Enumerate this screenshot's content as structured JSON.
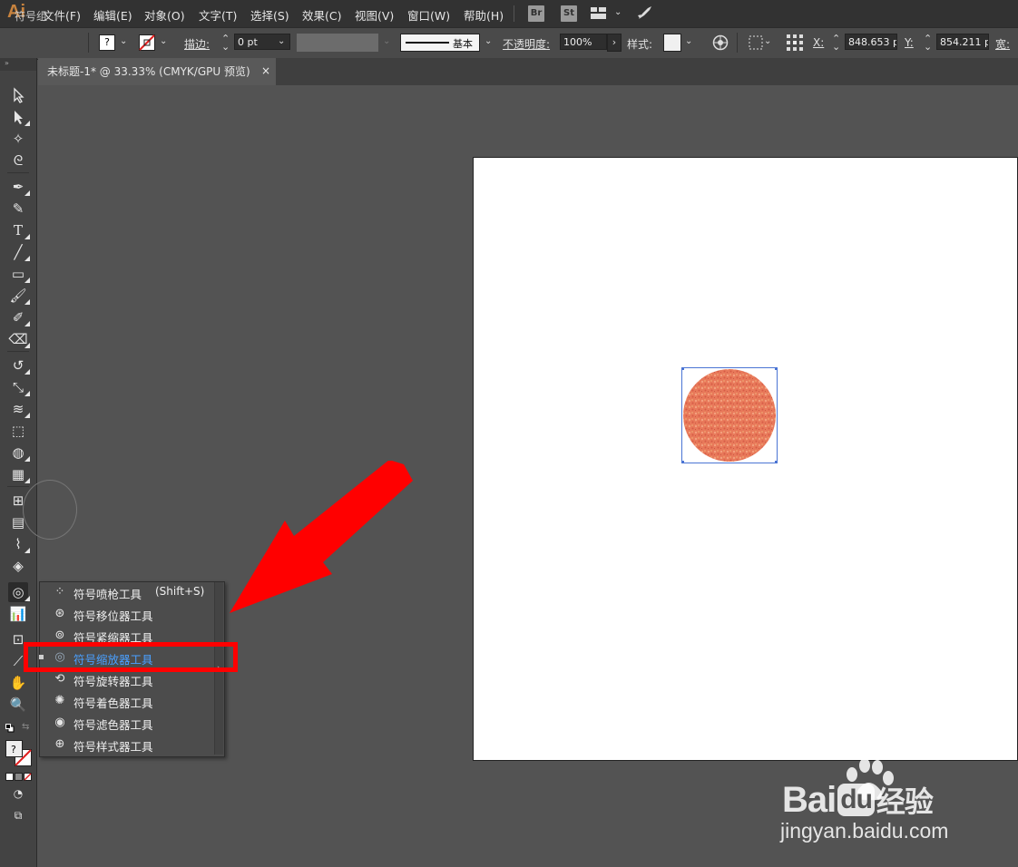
{
  "app": {
    "logo": "Ai"
  },
  "menubar": {
    "items": [
      {
        "label": "文件(F)"
      },
      {
        "label": "编辑(E)"
      },
      {
        "label": "对象(O)"
      },
      {
        "label": "文字(T)"
      },
      {
        "label": "选择(S)"
      },
      {
        "label": "效果(C)"
      },
      {
        "label": "视图(V)"
      },
      {
        "label": "窗口(W)"
      },
      {
        "label": "帮助(H)"
      }
    ],
    "bridge_label": "Br",
    "stock_label": "St"
  },
  "control_bar": {
    "selection_type": "符号组",
    "fill_swatch_text": "?",
    "stroke_label": "描边:",
    "stroke_weight": "0 pt",
    "stroke_profile": "基本",
    "opacity_label": "不透明度:",
    "opacity_value": "100%",
    "style_label": "样式:",
    "x_label": "X:",
    "x_value": "848.653 p",
    "y_label": "Y:",
    "y_value": "854.211 p",
    "width_label": "宽:"
  },
  "document": {
    "tab_title": "未标题-1* @ 33.33% (CMYK/GPU 预览)",
    "tab_close": "×"
  },
  "flyout": {
    "items": [
      {
        "label": "符号喷枪工具",
        "shortcut": "(Shift+S)",
        "icon": "symbol-sprayer-icon"
      },
      {
        "label": "符号移位器工具",
        "icon": "symbol-shifter-icon"
      },
      {
        "label": "符号紧缩器工具",
        "icon": "symbol-scruncher-icon"
      },
      {
        "label": "符号缩放器工具",
        "icon": "symbol-sizer-icon",
        "active": true
      },
      {
        "label": "符号旋转器工具",
        "icon": "symbol-spinner-icon"
      },
      {
        "label": "符号着色器工具",
        "icon": "symbol-stainer-icon"
      },
      {
        "label": "符号滤色器工具",
        "icon": "symbol-screener-icon"
      },
      {
        "label": "符号样式器工具",
        "icon": "symbol-styler-icon"
      }
    ]
  },
  "colors": {
    "highlight": "#ff0000",
    "active_item_text": "#4aa0ff",
    "symbol_fill": "#e8795a"
  },
  "watermark": {
    "brand_a": "Bai",
    "brand_b": "du",
    "brand_cn": "经验",
    "url": "jingyan.baidu.com"
  }
}
